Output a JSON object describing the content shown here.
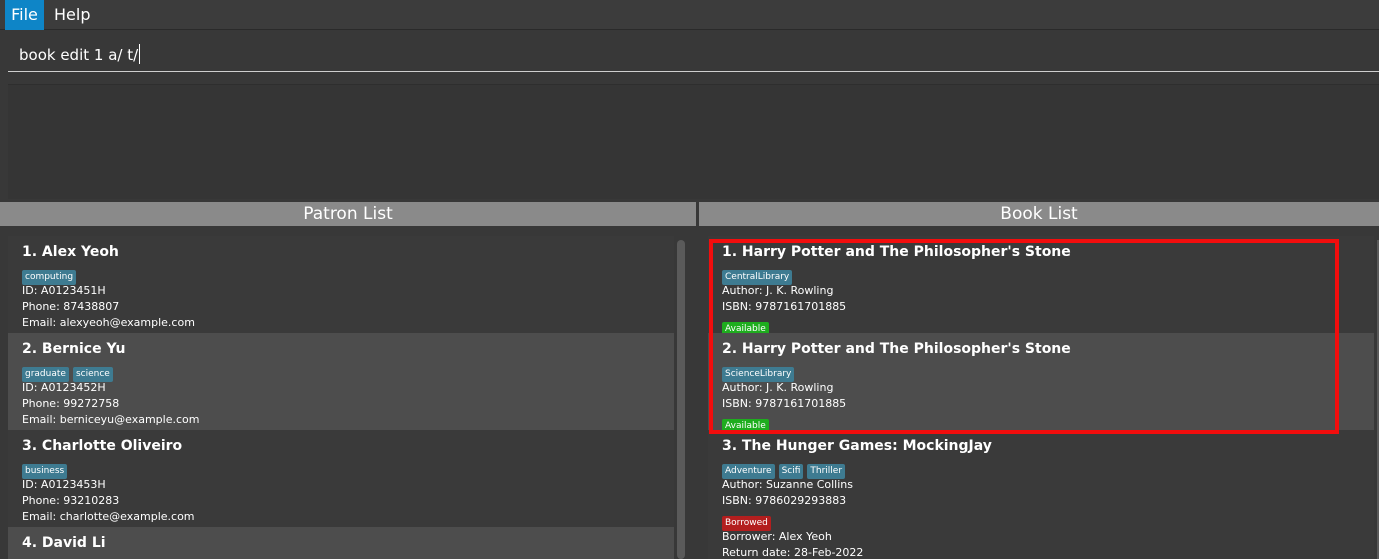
{
  "menu": {
    "file": "File",
    "help": "Help"
  },
  "command": {
    "value": "book edit 1 a/ t/"
  },
  "panels": {
    "patron_title": "Patron List",
    "book_title": "Book List"
  },
  "patrons": [
    {
      "title": "1.  Alex Yeoh",
      "tags": [
        "computing"
      ],
      "id": "ID: A0123451H",
      "phone": "Phone: 87438807",
      "email": "Email: alexyeoh@example.com"
    },
    {
      "title": "2.  Bernice Yu",
      "tags": [
        "graduate",
        "science"
      ],
      "id": "ID: A0123452H",
      "phone": "Phone: 99272758",
      "email": "Email: berniceyu@example.com"
    },
    {
      "title": "3.  Charlotte Oliveiro",
      "tags": [
        "business"
      ],
      "id": "ID: A0123453H",
      "phone": "Phone: 93210283",
      "email": "Email: charlotte@example.com"
    },
    {
      "title": "4.  David Li"
    }
  ],
  "books": [
    {
      "title": "1.  Harry Potter and The Philosopher's Stone",
      "tags": [
        "CentralLibrary"
      ],
      "author": "Author: J. K. Rowling",
      "isbn": "ISBN: 9787161701885",
      "status": "Available"
    },
    {
      "title": "2.  Harry Potter and The Philosopher's Stone",
      "tags": [
        "ScienceLibrary"
      ],
      "author": "Author: J. K. Rowling",
      "isbn": "ISBN: 9787161701885",
      "status": "Available"
    },
    {
      "title": "3.  The Hunger Games: MockingJay",
      "tags": [
        "Adventure",
        "Scifi",
        "Thriller"
      ],
      "author": "Author: Suzanne Collins",
      "isbn": "ISBN: 9786029293883",
      "status": "Borrowed",
      "borrower": "Borrower: Alex Yeoh",
      "return_date": "Return date: 28-Feb-2022"
    }
  ],
  "colors": {
    "accent": "#0e85c7",
    "tag": "#3e7b91",
    "available": "#1ead1e",
    "borrowed": "#b31e1e",
    "highlight": "#f20d0d"
  }
}
